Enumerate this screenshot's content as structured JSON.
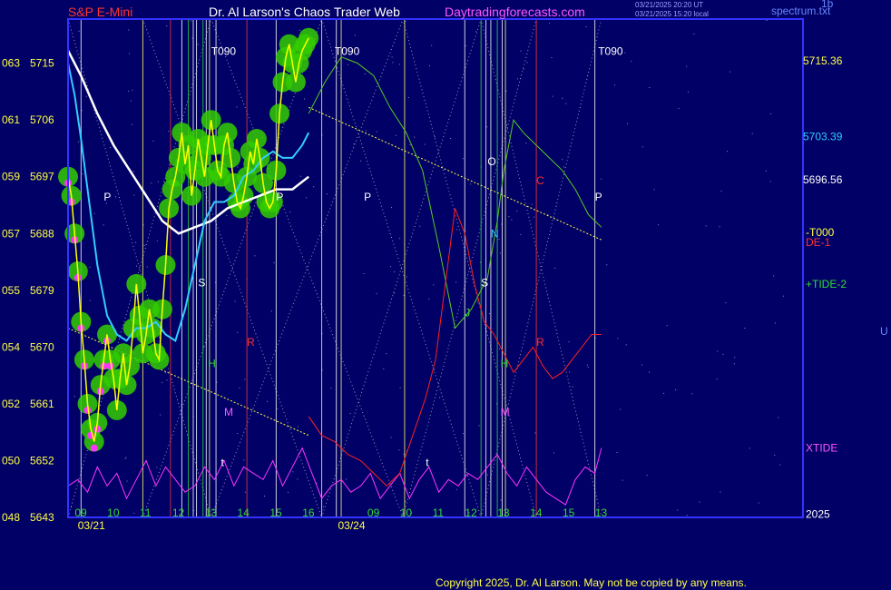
{
  "header": {
    "left_title": "S&P E-Mini",
    "center_title": "Dr. Al Larson's Chaos Trader Web",
    "site": "Daytradingforecasts.com",
    "timestamp_1": "03/21/2025 20:20 UT",
    "timestamp_2": "03/21/2025 15:20 local",
    "corner_top": "1b",
    "corner_site": "spectrum.txt",
    "right_edge_label": "U"
  },
  "footer": {
    "copyright": "Copyright 2025, Dr. Al Larson. May not be copied by any means."
  },
  "colors": {
    "background": "#000066",
    "frame": "#3333ff",
    "price": "#ffff00",
    "price_glow": "#33cc00",
    "fast_ma": "#33ccff",
    "slow_ma": "#ffffff",
    "upper_band": "#55cc22",
    "lower_band": "#2222ff",
    "red_line": "#ff2020",
    "magenta_line": "#ff33ff",
    "trend_line": "#ffff44"
  },
  "chart_data": {
    "type": "line",
    "y_axis": {
      "range": [
        5643,
        5722
      ],
      "ticks": [
        {
          "short": "048",
          "value": 5643
        },
        {
          "short": "050",
          "value": 5652
        },
        {
          "short": "052",
          "value": 5661
        },
        {
          "short": "054",
          "value": 5670
        },
        {
          "short": "055",
          "value": 5679
        },
        {
          "short": "057",
          "value": 5688
        },
        {
          "short": "059",
          "value": 5697
        },
        {
          "short": "061",
          "value": 5706
        },
        {
          "short": "063",
          "value": 5715
        }
      ]
    },
    "x_axis": {
      "range": [
        8.6,
        31.2
      ],
      "hour_ticks": [
        {
          "label": "09",
          "x": 9
        },
        {
          "label": "10",
          "x": 10
        },
        {
          "label": "11",
          "x": 11
        },
        {
          "label": "12",
          "x": 12
        },
        {
          "label": "13",
          "x": 13
        },
        {
          "label": "14",
          "x": 14
        },
        {
          "label": "15",
          "x": 15
        },
        {
          "label": "16",
          "x": 16
        },
        {
          "label": "09",
          "x": 18
        },
        {
          "label": "10",
          "x": 19
        },
        {
          "label": "11",
          "x": 20
        },
        {
          "label": "12",
          "x": 21
        },
        {
          "label": "13",
          "x": 22
        },
        {
          "label": "14",
          "x": 23
        },
        {
          "label": "15",
          "x": 24
        },
        {
          "label": "13",
          "x": 25
        }
      ],
      "date_labels": [
        {
          "label": "03/21",
          "x": 8.9
        },
        {
          "label": "03/24",
          "x": 16.9
        }
      ]
    },
    "right_values": [
      {
        "label": "5715.36",
        "value": 5715.36,
        "color": "#ffff44"
      },
      {
        "label": "5703.39",
        "value": 5703.39,
        "color": "#33ccff"
      },
      {
        "label": "5696.56",
        "value": 5696.56,
        "color": "#ffffff"
      }
    ],
    "right_labels": [
      {
        "label": "-T000",
        "value": 5688.2,
        "color": "#ffff44"
      },
      {
        "label": "DE-1",
        "value": 5686.6,
        "color": "#ff3030"
      },
      {
        "label": "+TIDE-2",
        "value": 5680,
        "color": "#33dd33"
      },
      {
        "label": "XTIDE",
        "value": 5654,
        "color": "#ff55ff"
      },
      {
        "label": "2025",
        "value": 5643.5,
        "color": "#ffffff"
      }
    ],
    "markers": [
      {
        "label": "T090",
        "x": 13.0,
        "value": 5716.3,
        "color": "#ffffff"
      },
      {
        "label": "T090",
        "x": 16.8,
        "value": 5716.3,
        "color": "#ffffff"
      },
      {
        "label": "T090",
        "x": 24.9,
        "value": 5716.3,
        "color": "#ffffff"
      },
      {
        "label": "P",
        "x": 9.7,
        "value": 5693.2,
        "color": "#ffffff"
      },
      {
        "label": "P",
        "x": 17.7,
        "value": 5693.2,
        "color": "#ffffff"
      },
      {
        "label": "P",
        "x": 24.8,
        "value": 5693.2,
        "color": "#ffffff"
      },
      {
        "label": "O",
        "x": 21.5,
        "value": 5698.8,
        "color": "#ffffff"
      },
      {
        "label": "C",
        "x": 23.0,
        "value": 5695.8,
        "color": "#ff3030"
      },
      {
        "label": "N",
        "x": 21.6,
        "value": 5687.4,
        "color": "#33ccff"
      },
      {
        "label": "S",
        "x": 12.6,
        "value": 5679.6,
        "color": "#ffffff"
      },
      {
        "label": "S",
        "x": 21.3,
        "value": 5679.6,
        "color": "#ffffff"
      },
      {
        "label": "J",
        "x": 20.8,
        "value": 5674.9,
        "color": "#33dd33"
      },
      {
        "label": "H",
        "x": 12.9,
        "value": 5666.8,
        "color": "#33dd33"
      },
      {
        "label": "H",
        "x": 21.9,
        "value": 5666.8,
        "color": "#33dd33"
      },
      {
        "label": "M",
        "x": 13.4,
        "value": 5659.1,
        "color": "#ff55ff"
      },
      {
        "label": "M",
        "x": 21.9,
        "value": 5659.1,
        "color": "#ff55ff"
      },
      {
        "label": "t",
        "x": 13.3,
        "value": 5651.1,
        "color": "#ffffff"
      },
      {
        "label": "t",
        "x": 19.6,
        "value": 5651.1,
        "color": "#ffffff"
      },
      {
        "label": "R",
        "x": 14.1,
        "value": 5670.2,
        "color": "#ff3030"
      },
      {
        "label": "R",
        "x": 23.0,
        "value": 5670.2,
        "color": "#ff3030"
      },
      {
        "label": "P",
        "x": 15.0,
        "value": 5693.2,
        "color": "#ffffff"
      }
    ],
    "vlines": [
      {
        "x": 9.0,
        "color": "#ffffff"
      },
      {
        "x": 10.9,
        "color": "#ffff66"
      },
      {
        "x": 11.75,
        "color": "#ff3333"
      },
      {
        "x": 12.1,
        "color": "#ffffff"
      },
      {
        "x": 12.3,
        "color": "#33dd33"
      },
      {
        "x": 12.45,
        "color": "#ffffff"
      },
      {
        "x": 12.55,
        "color": "#ffffff"
      },
      {
        "x": 12.75,
        "color": "#33dd33"
      },
      {
        "x": 12.85,
        "color": "#ffffff"
      },
      {
        "x": 12.95,
        "color": "#ffff66"
      },
      {
        "x": 13.15,
        "color": "#ffffff"
      },
      {
        "x": 14.1,
        "color": "#ff3333"
      },
      {
        "x": 15.0,
        "color": "#ffffff"
      },
      {
        "x": 16.4,
        "color": "#ffff66"
      },
      {
        "x": 16.85,
        "color": "#ffffff"
      },
      {
        "x": 17.0,
        "color": "#ffff66"
      },
      {
        "x": 18.95,
        "color": "#ffff66"
      },
      {
        "x": 20.8,
        "color": "#ffffff"
      },
      {
        "x": 21.3,
        "color": "#33dd33"
      },
      {
        "x": 21.45,
        "color": "#ffffff"
      },
      {
        "x": 21.6,
        "color": "#ffffff"
      },
      {
        "x": 21.8,
        "color": "#33dd33"
      },
      {
        "x": 21.95,
        "color": "#ffffff"
      },
      {
        "x": 22.05,
        "color": "#ffff66"
      },
      {
        "x": 23.0,
        "color": "#ff3333"
      },
      {
        "x": 24.8,
        "color": "#ffffff"
      }
    ],
    "series": [
      {
        "key": "slow_ma",
        "x": [
          8.6,
          9.0,
          9.5,
          10.0,
          10.5,
          11.0,
          11.5,
          12.0,
          12.5,
          13.0,
          13.5,
          14.0,
          14.5,
          15.0,
          15.5,
          16.0
        ],
        "y": [
          5717,
          5713,
          5707,
          5702,
          5698,
          5694,
          5690,
          5688,
          5689,
          5690,
          5692,
          5693,
          5694,
          5695,
          5695,
          5697
        ]
      },
      {
        "key": "fast_ma",
        "x": [
          8.6,
          8.8,
          9.0,
          9.2,
          9.5,
          9.8,
          10.1,
          10.4,
          10.7,
          11.0,
          11.3,
          11.6,
          11.9,
          12.2,
          12.5,
          12.8,
          13.1,
          13.4,
          13.7,
          14.0,
          14.3,
          14.6,
          14.9,
          15.2,
          15.5,
          15.8,
          16.0
        ],
        "y": [
          5715,
          5710,
          5703,
          5695,
          5683,
          5675,
          5672,
          5671,
          5673,
          5673,
          5674,
          5672,
          5671,
          5676,
          5683,
          5690,
          5693,
          5693,
          5694,
          5697,
          5698,
          5700,
          5701,
          5700,
          5700,
          5702,
          5704
        ]
      },
      {
        "key": "price",
        "x": [
          8.6,
          8.7,
          8.8,
          8.9,
          9.0,
          9.1,
          9.2,
          9.3,
          9.4,
          9.5,
          9.6,
          9.7,
          9.8,
          9.9,
          10.0,
          10.1,
          10.2,
          10.3,
          10.4,
          10.5,
          10.6,
          10.7,
          10.8,
          10.9,
          11.0,
          11.1,
          11.2,
          11.3,
          11.4,
          11.5,
          11.6,
          11.7,
          11.8,
          11.9,
          12.0,
          12.1,
          12.2,
          12.3,
          12.4,
          12.5,
          12.6,
          12.7,
          12.8,
          12.9,
          13.0,
          13.1,
          13.2,
          13.3,
          13.4,
          13.5,
          13.6,
          13.7,
          13.8,
          13.9,
          14.0,
          14.1,
          14.2,
          14.3,
          14.4,
          14.5,
          14.6,
          14.7,
          14.8,
          14.9,
          15.0,
          15.1,
          15.2,
          15.3,
          15.4,
          15.5,
          15.6,
          15.7,
          15.8,
          15.9,
          16.0
        ],
        "y": [
          5697,
          5694,
          5688,
          5682,
          5674,
          5668,
          5661,
          5657,
          5655,
          5658,
          5664,
          5668,
          5672,
          5668,
          5665,
          5660,
          5665,
          5669,
          5664,
          5667,
          5673,
          5680,
          5675,
          5669,
          5672,
          5676,
          5673,
          5669,
          5668,
          5676,
          5683,
          5692,
          5695,
          5697,
          5700,
          5704,
          5699,
          5702,
          5694,
          5698,
          5703,
          5700,
          5697,
          5702,
          5706,
          5702,
          5698,
          5697,
          5702,
          5704,
          5700,
          5696,
          5693,
          5692,
          5694,
          5697,
          5701,
          5699,
          5703,
          5700,
          5696,
          5693,
          5692,
          5693,
          5698,
          5707,
          5712,
          5716,
          5718,
          5715,
          5712,
          5715,
          5717,
          5718,
          5719
        ]
      },
      {
        "key": "upper_band",
        "x": [
          16.0,
          16.5,
          17.0,
          17.5,
          18.0,
          18.5,
          19.0,
          19.5,
          20.0,
          20.5,
          21.0,
          21.5,
          21.8,
          22.0,
          22.3,
          22.6,
          23.0,
          23.4,
          23.8,
          24.2,
          24.6,
          25.0
        ],
        "y": [
          5707,
          5712,
          5716,
          5715,
          5713,
          5708,
          5704,
          5698,
          5686,
          5673,
          5676,
          5681,
          5690,
          5698,
          5706,
          5704,
          5702,
          5700,
          5698,
          5695,
          5691,
          5689
        ]
      },
      {
        "key": "red_line",
        "x": [
          16.0,
          16.4,
          16.8,
          17.2,
          17.6,
          18.0,
          18.4,
          18.8,
          19.2,
          19.6,
          19.9,
          20.2,
          20.5,
          20.8,
          21.1,
          21.4,
          21.7,
          22.0,
          22.3,
          22.6,
          22.9,
          23.2,
          23.5,
          23.8,
          24.1,
          24.4,
          24.7,
          25.0
        ],
        "y": [
          5659,
          5656,
          5655,
          5653,
          5652,
          5650,
          5648,
          5650,
          5656,
          5662,
          5668,
          5680,
          5692,
          5688,
          5680,
          5674,
          5672,
          5669,
          5666,
          5668,
          5670,
          5667,
          5665,
          5666,
          5668,
          5670,
          5672,
          5672
        ]
      },
      {
        "key": "magenta_line",
        "x": [
          8.6,
          8.9,
          9.2,
          9.5,
          9.8,
          10.1,
          10.4,
          10.7,
          11.0,
          11.3,
          11.6,
          11.9,
          12.2,
          12.5,
          12.8,
          13.1,
          13.4,
          13.7,
          14.0,
          14.3,
          14.6,
          14.9,
          15.2,
          15.5,
          15.8,
          16.1,
          16.4,
          16.7,
          17.0,
          17.3,
          17.6,
          17.9,
          18.2,
          18.5,
          18.8,
          19.1,
          19.4,
          19.7,
          20.0,
          20.3,
          20.6,
          20.9,
          21.2,
          21.5,
          21.8,
          22.1,
          22.4,
          22.7,
          23.0,
          23.3,
          23.6,
          23.9,
          24.2,
          24.5,
          24.8,
          25.0
        ],
        "y": [
          5648,
          5649,
          5647,
          5651,
          5648,
          5650,
          5646,
          5649,
          5652,
          5648,
          5651,
          5649,
          5647,
          5648,
          5651,
          5649,
          5652,
          5648,
          5651,
          5650,
          5649,
          5652,
          5648,
          5651,
          5654,
          5650,
          5646,
          5648,
          5649,
          5647,
          5648,
          5650,
          5646,
          5648,
          5650,
          5646,
          5649,
          5651,
          5647,
          5649,
          5648,
          5650,
          5649,
          5651,
          5653,
          5650,
          5648,
          5651,
          5649,
          5647,
          5646,
          5645,
          5649,
          5651,
          5650,
          5654
        ]
      }
    ]
  }
}
